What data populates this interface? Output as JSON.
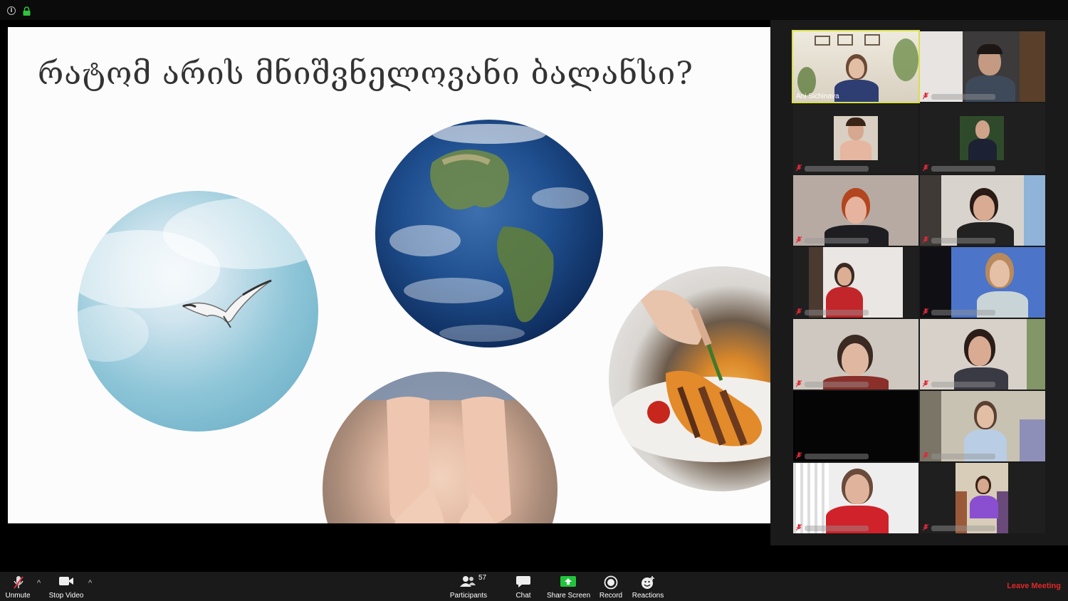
{
  "slide": {
    "title": "რატომ არის მნიშვნელოვანი ბალანსი?"
  },
  "participants_panel": {
    "active_speaker_name": "Ani Sichinava",
    "tiles": [
      {
        "name": "Ani Sichinava",
        "muted": false,
        "active": true
      },
      {
        "name": "",
        "muted": true
      },
      {
        "name": "",
        "muted": true
      },
      {
        "name": "",
        "muted": true
      },
      {
        "name": "",
        "muted": true
      },
      {
        "name": "",
        "muted": true
      },
      {
        "name": "",
        "muted": true
      },
      {
        "name": "",
        "muted": true
      },
      {
        "name": "",
        "muted": true
      },
      {
        "name": "",
        "muted": true
      },
      {
        "name": "",
        "muted": true
      },
      {
        "name": "",
        "muted": true
      },
      {
        "name": "",
        "muted": true
      },
      {
        "name": "",
        "muted": true
      }
    ]
  },
  "toolbar": {
    "unmute_label": "Unmute",
    "stop_video_label": "Stop Video",
    "participants_label": "Participants",
    "participants_count": "57",
    "chat_label": "Chat",
    "share_screen_label": "Share Screen",
    "record_label": "Record",
    "reactions_label": "Reactions",
    "leave_label": "Leave Meeting"
  },
  "colors": {
    "leave": "#e02828",
    "share_green": "#21c43c",
    "active_border": "#d7e04a",
    "muted_red": "#e0283a"
  }
}
